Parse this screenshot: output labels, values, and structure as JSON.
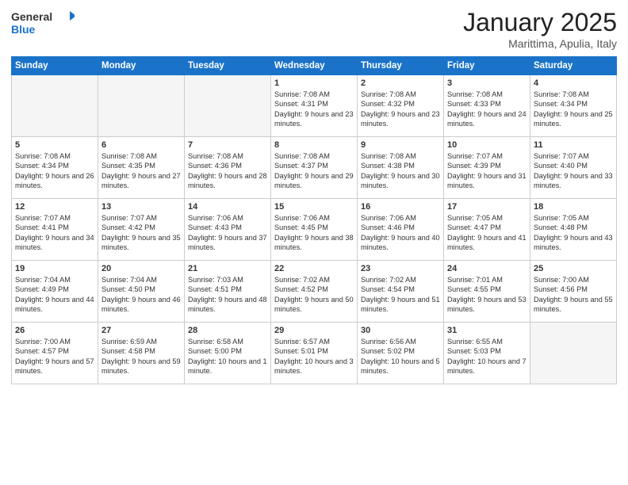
{
  "header": {
    "logo_general": "General",
    "logo_blue": "Blue",
    "month": "January 2025",
    "location": "Marittima, Apulia, Italy"
  },
  "weekdays": [
    "Sunday",
    "Monday",
    "Tuesday",
    "Wednesday",
    "Thursday",
    "Friday",
    "Saturday"
  ],
  "weeks": [
    [
      {
        "day": "",
        "empty": true
      },
      {
        "day": "",
        "empty": true
      },
      {
        "day": "",
        "empty": true
      },
      {
        "day": "1",
        "empty": false,
        "sunrise": "7:08 AM",
        "sunset": "4:31 PM",
        "daylight": "9 hours and 23 minutes."
      },
      {
        "day": "2",
        "empty": false,
        "sunrise": "7:08 AM",
        "sunset": "4:32 PM",
        "daylight": "9 hours and 23 minutes."
      },
      {
        "day": "3",
        "empty": false,
        "sunrise": "7:08 AM",
        "sunset": "4:33 PM",
        "daylight": "9 hours and 24 minutes."
      },
      {
        "day": "4",
        "empty": false,
        "sunrise": "7:08 AM",
        "sunset": "4:34 PM",
        "daylight": "9 hours and 25 minutes."
      }
    ],
    [
      {
        "day": "5",
        "empty": false,
        "sunrise": "7:08 AM",
        "sunset": "4:34 PM",
        "daylight": "9 hours and 26 minutes."
      },
      {
        "day": "6",
        "empty": false,
        "sunrise": "7:08 AM",
        "sunset": "4:35 PM",
        "daylight": "9 hours and 27 minutes."
      },
      {
        "day": "7",
        "empty": false,
        "sunrise": "7:08 AM",
        "sunset": "4:36 PM",
        "daylight": "9 hours and 28 minutes."
      },
      {
        "day": "8",
        "empty": false,
        "sunrise": "7:08 AM",
        "sunset": "4:37 PM",
        "daylight": "9 hours and 29 minutes."
      },
      {
        "day": "9",
        "empty": false,
        "sunrise": "7:08 AM",
        "sunset": "4:38 PM",
        "daylight": "9 hours and 30 minutes."
      },
      {
        "day": "10",
        "empty": false,
        "sunrise": "7:07 AM",
        "sunset": "4:39 PM",
        "daylight": "9 hours and 31 minutes."
      },
      {
        "day": "11",
        "empty": false,
        "sunrise": "7:07 AM",
        "sunset": "4:40 PM",
        "daylight": "9 hours and 33 minutes."
      }
    ],
    [
      {
        "day": "12",
        "empty": false,
        "sunrise": "7:07 AM",
        "sunset": "4:41 PM",
        "daylight": "9 hours and 34 minutes."
      },
      {
        "day": "13",
        "empty": false,
        "sunrise": "7:07 AM",
        "sunset": "4:42 PM",
        "daylight": "9 hours and 35 minutes."
      },
      {
        "day": "14",
        "empty": false,
        "sunrise": "7:06 AM",
        "sunset": "4:43 PM",
        "daylight": "9 hours and 37 minutes."
      },
      {
        "day": "15",
        "empty": false,
        "sunrise": "7:06 AM",
        "sunset": "4:45 PM",
        "daylight": "9 hours and 38 minutes."
      },
      {
        "day": "16",
        "empty": false,
        "sunrise": "7:06 AM",
        "sunset": "4:46 PM",
        "daylight": "9 hours and 40 minutes."
      },
      {
        "day": "17",
        "empty": false,
        "sunrise": "7:05 AM",
        "sunset": "4:47 PM",
        "daylight": "9 hours and 41 minutes."
      },
      {
        "day": "18",
        "empty": false,
        "sunrise": "7:05 AM",
        "sunset": "4:48 PM",
        "daylight": "9 hours and 43 minutes."
      }
    ],
    [
      {
        "day": "19",
        "empty": false,
        "sunrise": "7:04 AM",
        "sunset": "4:49 PM",
        "daylight": "9 hours and 44 minutes."
      },
      {
        "day": "20",
        "empty": false,
        "sunrise": "7:04 AM",
        "sunset": "4:50 PM",
        "daylight": "9 hours and 46 minutes."
      },
      {
        "day": "21",
        "empty": false,
        "sunrise": "7:03 AM",
        "sunset": "4:51 PM",
        "daylight": "9 hours and 48 minutes."
      },
      {
        "day": "22",
        "empty": false,
        "sunrise": "7:02 AM",
        "sunset": "4:52 PM",
        "daylight": "9 hours and 50 minutes."
      },
      {
        "day": "23",
        "empty": false,
        "sunrise": "7:02 AM",
        "sunset": "4:54 PM",
        "daylight": "9 hours and 51 minutes."
      },
      {
        "day": "24",
        "empty": false,
        "sunrise": "7:01 AM",
        "sunset": "4:55 PM",
        "daylight": "9 hours and 53 minutes."
      },
      {
        "day": "25",
        "empty": false,
        "sunrise": "7:00 AM",
        "sunset": "4:56 PM",
        "daylight": "9 hours and 55 minutes."
      }
    ],
    [
      {
        "day": "26",
        "empty": false,
        "sunrise": "7:00 AM",
        "sunset": "4:57 PM",
        "daylight": "9 hours and 57 minutes."
      },
      {
        "day": "27",
        "empty": false,
        "sunrise": "6:59 AM",
        "sunset": "4:58 PM",
        "daylight": "9 hours and 59 minutes."
      },
      {
        "day": "28",
        "empty": false,
        "sunrise": "6:58 AM",
        "sunset": "5:00 PM",
        "daylight": "10 hours and 1 minute."
      },
      {
        "day": "29",
        "empty": false,
        "sunrise": "6:57 AM",
        "sunset": "5:01 PM",
        "daylight": "10 hours and 3 minutes."
      },
      {
        "day": "30",
        "empty": false,
        "sunrise": "6:56 AM",
        "sunset": "5:02 PM",
        "daylight": "10 hours and 5 minutes."
      },
      {
        "day": "31",
        "empty": false,
        "sunrise": "6:55 AM",
        "sunset": "5:03 PM",
        "daylight": "10 hours and 7 minutes."
      },
      {
        "day": "",
        "empty": true
      }
    ]
  ]
}
